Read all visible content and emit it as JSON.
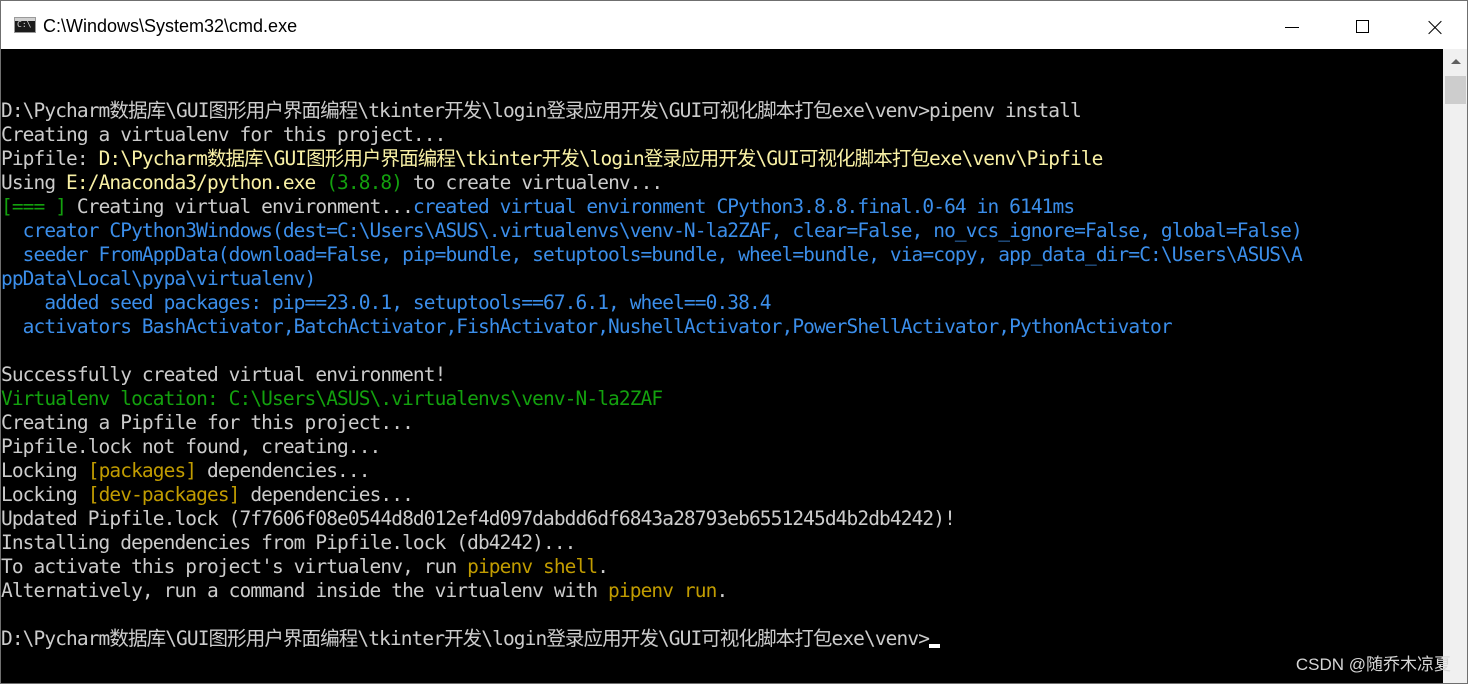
{
  "window": {
    "icon_text": "C:\\",
    "title": "C:\\Windows\\System32\\cmd.exe",
    "controls": [
      "minimize",
      "maximize",
      "close"
    ]
  },
  "console": {
    "lines": [
      [],
      [
        {
          "t": "D:\\Pycharm数据库\\GUI图形用户界面编程\\tkinter开发\\login登录应用开发\\GUI可视化脚本打包exe\\venv>pipenv install",
          "c": "c-gray"
        }
      ],
      [
        {
          "t": "Creating a virtualenv for this project...",
          "c": "c-gray"
        }
      ],
      [
        {
          "t": "Pipfile: ",
          "c": "c-gray"
        },
        {
          "t": "D:\\Pycharm数据库\\GUI图形用户界面编程\\tkinter开发\\login登录应用开发\\GUI可视化脚本打包exe\\venv\\Pipfile",
          "c": "c-yellow"
        }
      ],
      [
        {
          "t": "Using ",
          "c": "c-gray"
        },
        {
          "t": "E:/Anaconda3/python.exe",
          "c": "c-yellow"
        },
        {
          "t": " (3.8.8)",
          "c": "c-green"
        },
        {
          "t": " to create virtualenv...",
          "c": "c-gray"
        }
      ],
      [
        {
          "t": "[=== ]",
          "c": "c-green"
        },
        {
          "t": " Creating virtual environment...",
          "c": "c-gray"
        },
        {
          "t": "created virtual environment CPython3.8.8.final.0-64 in 6141ms",
          "c": "c-blue"
        }
      ],
      [
        {
          "t": "  creator CPython3Windows(dest=C:\\Users\\ASUS\\.virtualenvs\\venv-N-la2ZAF, clear=False, no_vcs_ignore=False, global=False)",
          "c": "c-blue"
        }
      ],
      [
        {
          "t": "  seeder FromAppData(download=False, pip=bundle, setuptools=bundle, wheel=bundle, via=copy, app_data_dir=C:\\Users\\ASUS\\A",
          "c": "c-blue"
        }
      ],
      [
        {
          "t": "ppData\\Local\\pypa\\virtualenv)",
          "c": "c-blue"
        }
      ],
      [
        {
          "t": "    added seed packages: pip==23.0.1, setuptools==67.6.1, wheel==0.38.4",
          "c": "c-blue"
        }
      ],
      [
        {
          "t": "  activators BashActivator,BatchActivator,FishActivator,NushellActivator,PowerShellActivator,PythonActivator",
          "c": "c-blue"
        }
      ],
      [],
      [
        {
          "t": "Successfully created virtual environment!",
          "c": "c-gray"
        }
      ],
      [
        {
          "t": "Virtualenv location: C:\\Users\\ASUS\\.virtualenvs\\venv-N-la2ZAF",
          "c": "c-green"
        }
      ],
      [
        {
          "t": "Creating a Pipfile for this project...",
          "c": "c-gray"
        }
      ],
      [
        {
          "t": "Pipfile.lock not found, creating...",
          "c": "c-gray"
        }
      ],
      [
        {
          "t": "Locking ",
          "c": "c-gray"
        },
        {
          "t": "[packages]",
          "c": "c-gold"
        },
        {
          "t": " dependencies...",
          "c": "c-gray"
        }
      ],
      [
        {
          "t": "Locking ",
          "c": "c-gray"
        },
        {
          "t": "[dev-packages]",
          "c": "c-gold"
        },
        {
          "t": " dependencies...",
          "c": "c-gray"
        }
      ],
      [
        {
          "t": "Updated Pipfile.lock (7f7606f08e0544d8d012ef4d097dabdd6df6843a28793eb6551245d4b2db4242)!",
          "c": "c-gray"
        }
      ],
      [
        {
          "t": "Installing dependencies from Pipfile.lock (db4242)...",
          "c": "c-gray"
        }
      ],
      [
        {
          "t": "To activate this project's virtualenv, run ",
          "c": "c-gray"
        },
        {
          "t": "pipenv shell",
          "c": "c-gold"
        },
        {
          "t": ".",
          "c": "c-gray"
        }
      ],
      [
        {
          "t": "Alternatively, run a command inside the virtualenv with ",
          "c": "c-gray"
        },
        {
          "t": "pipenv run",
          "c": "c-gold"
        },
        {
          "t": ".",
          "c": "c-gray"
        }
      ],
      [],
      [
        {
          "t": "D:\\Pycharm数据库\\GUI图形用户界面编程\\tkinter开发\\login登录应用开发\\GUI可视化脚本打包exe\\venv>",
          "c": "c-gray"
        },
        {
          "cursor": true
        }
      ]
    ]
  },
  "watermark": "CSDN @随乔木凉夏",
  "colors": {
    "background": "#000000",
    "default_text": "#cccccc",
    "yellow": "#f9f1a5",
    "blue": "#3b8eea",
    "green": "#13a10e",
    "gold": "#c19c00"
  }
}
